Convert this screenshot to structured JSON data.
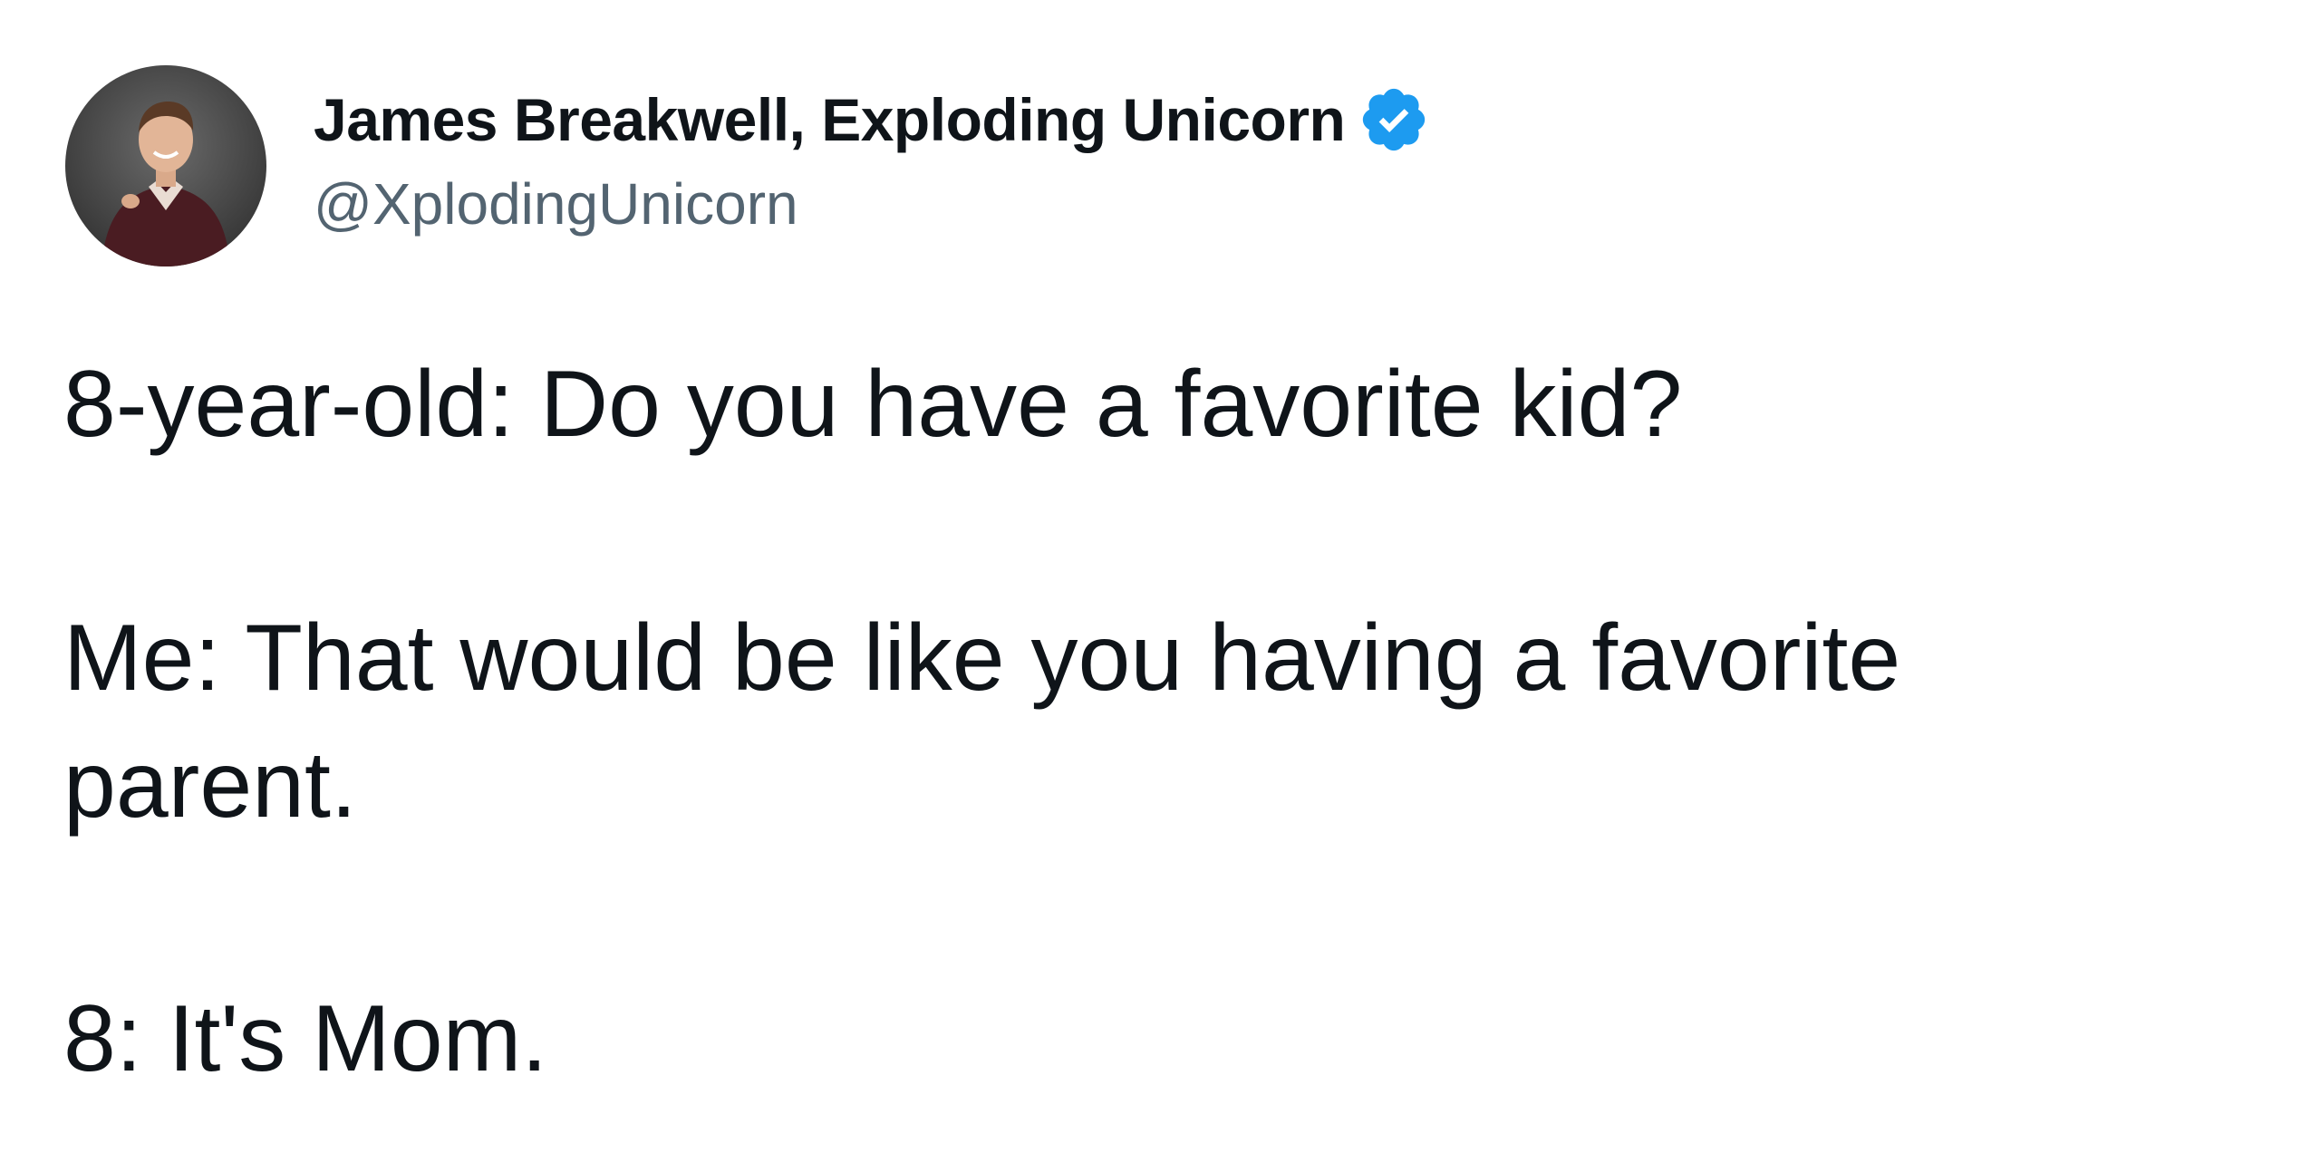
{
  "author": {
    "display_name": "James Breakwell, Exploding Unicorn",
    "handle": "@XplodingUnicorn",
    "verified": true,
    "verified_icon": "verified-badge-icon",
    "badge_color": "#1d9bf0"
  },
  "tweet": {
    "paragraphs": [
      {
        "lines": [
          "8-year-old: Do you have a favorite kid?"
        ]
      },
      {
        "lines": [
          "Me: That would be like you having a favorite",
          "parent."
        ]
      },
      {
        "lines": [
          "8: It's Mom."
        ]
      }
    ]
  },
  "colors": {
    "text": "#0f1419",
    "handle": "#536471",
    "background": "#ffffff"
  }
}
